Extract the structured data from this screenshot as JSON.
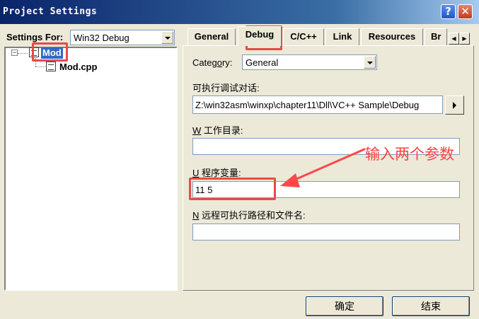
{
  "window": {
    "title": "Project Settings",
    "help_glyph": "?",
    "close_glyph": "✕"
  },
  "settings_for": {
    "label": "Settings For:",
    "value": "Win32 Debug"
  },
  "tree": {
    "root": "Mod",
    "child": "Mod.cpp",
    "expander": "−"
  },
  "tabs": [
    {
      "label": "General"
    },
    {
      "label": "Debug"
    },
    {
      "label": "C/C++"
    },
    {
      "label": "Link"
    },
    {
      "label": "Resources"
    },
    {
      "label": "Br"
    }
  ],
  "tab_scroll": {
    "left": "◀",
    "right": "▶"
  },
  "debug": {
    "category_label_pre": "Categ",
    "category_label_u": "o",
    "category_label_post": "ry:",
    "category_value": "General",
    "exe_label": "可执行调试对话:",
    "exe_value": "Z:\\win32asm\\winxp\\chapter11\\Dll\\VC++ Sample\\Debug",
    "workdir_label_u": "W",
    "workdir_label": " 工作目录:",
    "workdir_value": "",
    "args_label_u": "U",
    "args_label": " 程序变量:",
    "args_value": "11 5",
    "remote_label_u": "N",
    "remote_label": " 远程可执行路径和文件名:",
    "remote_value": ""
  },
  "buttons": {
    "ok": "确定",
    "cancel": "结束"
  },
  "annotation": {
    "text": "输入两个参数",
    "color": "#ff4040"
  }
}
